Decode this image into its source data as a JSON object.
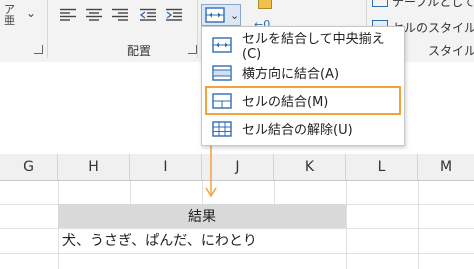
{
  "ribbon": {
    "left_fragment": "ア\n亜",
    "collapse_chevron": "⌄",
    "alignment_group_label": "配置",
    "styles_group_label": "スタイル",
    "number_fragment": "←0",
    "styles_table_fragment": "テーブルとして書",
    "cell_styles_label": "セルのスタイル",
    "cell_styles_chevron": "⌄",
    "currency_fragment": "∞"
  },
  "merge_dropdown": {
    "items": [
      {
        "label": "セルを結合して中央揃え(C)"
      },
      {
        "label": "横方向に結合(A)"
      },
      {
        "label": "セルの結合(M)"
      },
      {
        "label": "セル結合の解除(U)"
      }
    ]
  },
  "grid": {
    "columns": [
      "G",
      "H",
      "I",
      "J",
      "K",
      "L",
      "M"
    ],
    "merged_cell_text": "結果",
    "data_cell_text": "犬、うさぎ、ぱんだ、にわとり"
  },
  "colors": {
    "ribbon_bg": "#f3f3f3",
    "accent_blue": "#2f6db3",
    "highlight_orange": "#f4a23a",
    "merged_cell_bg": "#d9d9d9"
  }
}
